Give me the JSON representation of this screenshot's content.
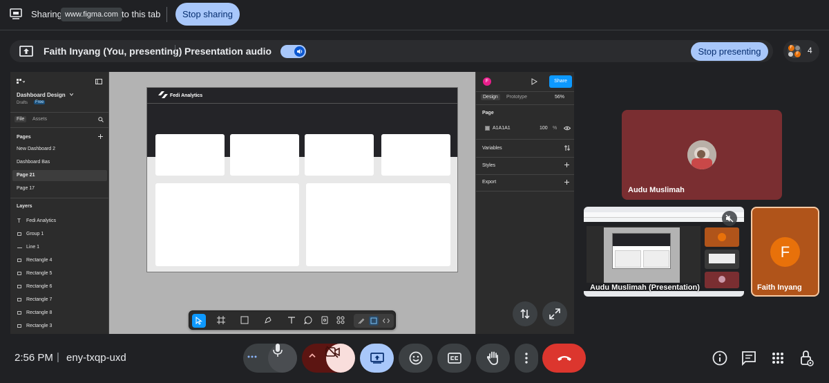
{
  "share_bar": {
    "sharing_label": "Sharing",
    "domain": "www.figma.com",
    "suffix": "to this tab",
    "stop_sharing": "Stop sharing"
  },
  "presenting_bar": {
    "presenter": "Faith Inyang (You, presenting)",
    "audio_label": "Presentation audio",
    "audio_enabled": true,
    "stop_presenting": "Stop presenting",
    "participant_count": "4",
    "avatar_letters": [
      "F",
      "F"
    ]
  },
  "figma": {
    "file_name": "Dashboard Design",
    "location": "Drafts",
    "plan_badge": "Free",
    "tabs": [
      "File",
      "Assets"
    ],
    "pages_heading": "Pages",
    "pages": [
      {
        "label": "New Dashboard 2",
        "selected": false
      },
      {
        "label": "Dashboard Bas",
        "selected": false
      },
      {
        "label": "Page 21",
        "selected": true
      },
      {
        "label": "Page 17",
        "selected": false
      }
    ],
    "layers_heading": "Layers",
    "layers": [
      {
        "label": "Fedi Analytics",
        "icon": "text-icon"
      },
      {
        "label": "Group 1",
        "icon": "group-icon"
      },
      {
        "label": "Line 1",
        "icon": "line-icon"
      },
      {
        "label": "Rectangle 4",
        "icon": "rectangle-icon"
      },
      {
        "label": "Rectangle 5",
        "icon": "rectangle-icon"
      },
      {
        "label": "Rectangle 6",
        "icon": "rectangle-icon"
      },
      {
        "label": "Rectangle 7",
        "icon": "rectangle-icon"
      },
      {
        "label": "Rectangle 8",
        "icon": "rectangle-icon"
      },
      {
        "label": "Rectangle 3",
        "icon": "rectangle-icon"
      }
    ],
    "canvas_brand": "Fedi Analytics",
    "right": {
      "avatar_letter": "F",
      "share_label": "Share",
      "tabs": [
        "Design",
        "Prototype"
      ],
      "zoom": "56%",
      "page_heading": "Page",
      "page_fill_hex": "A1A1A1",
      "page_opacity": "100",
      "percent_sign": "%",
      "variables": "Variables",
      "styles": "Styles",
      "export": "Export"
    },
    "colors": {
      "canvas_bg": "#b3b3b3",
      "accent": "#0d99ff",
      "page_fill": "#a1a1a1"
    }
  },
  "tiles": [
    {
      "name": "Audu Muslimah",
      "kind": "avatar-photo"
    },
    {
      "name": "Audu Muslimah (Presentation)",
      "kind": "screen-share",
      "muted": true
    },
    {
      "name": "Faith Inyang",
      "kind": "letter-avatar",
      "letter": "F"
    }
  ],
  "bottom_bar": {
    "time": "2:56 PM",
    "separator": "|",
    "meeting_code": "eny-txqp-uxd",
    "controls": [
      "more-options-icon",
      "mic-icon",
      "chevron-up-icon",
      "camera-off-icon",
      "present-icon",
      "emoji-icon",
      "captions-icon",
      "raise-hand-icon",
      "more-vert-icon",
      "end-call-icon"
    ],
    "right_controls": [
      "info-icon",
      "chat-icon",
      "apps-icon",
      "host-controls-icon"
    ]
  },
  "colors": {
    "background": "#202124",
    "accent_blue": "#a8c7fa",
    "end_call": "#ea4335",
    "tile_red": "#7a2e31",
    "tile_orange": "#b0541a",
    "faith_avatar": "#e8710a"
  }
}
